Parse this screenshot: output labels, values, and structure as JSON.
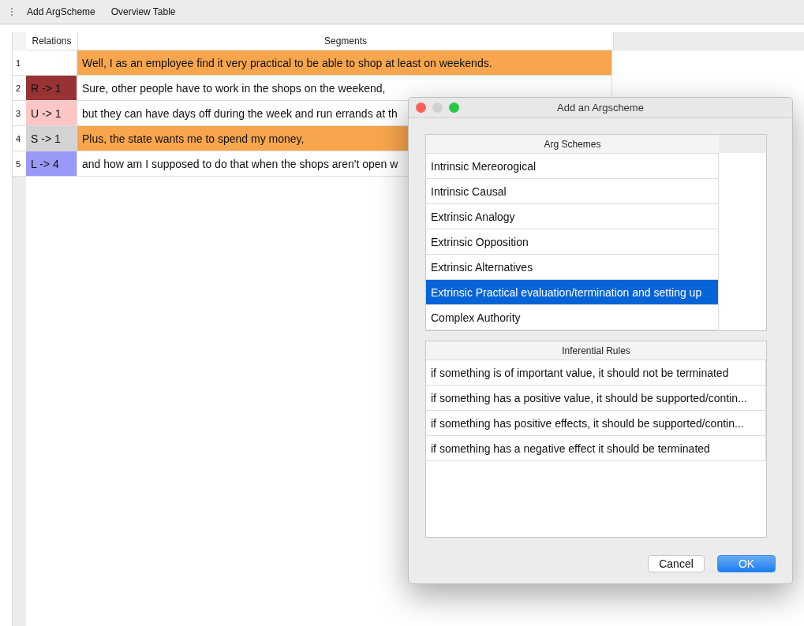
{
  "toolbar": {
    "items": [
      {
        "label": "Add ArgScheme"
      },
      {
        "label": "Overview Table"
      }
    ]
  },
  "table": {
    "columns": [
      "Relations",
      "Segments"
    ],
    "rows": [
      {
        "number": "1",
        "relation": {
          "color": "#ffffff"
        },
        "segment": {
          "text": "Well, I as an employee find it very practical to be able to shop at least on weekends.",
          "color": "#f8a64d"
        }
      },
      {
        "number": "2",
        "relation": {
          "text": "R -> 1",
          "color": "#993333"
        },
        "segment": {
          "text": "Sure, other people have to work in the shops on the weekend,",
          "color": "#ffffff"
        }
      },
      {
        "number": "3",
        "relation": {
          "text": "U -> 1",
          "color": "#ffc6c6"
        },
        "segment": {
          "text": "but they can have days off during the week and run errands at th",
          "color": "#ffffff"
        }
      },
      {
        "number": "4",
        "relation": {
          "text": "S -> 1",
          "color": "#d3d3d3"
        },
        "segment": {
          "text": "Plus, the state wants me to spend my money,",
          "color": "#f8a64d"
        }
      },
      {
        "number": "5",
        "relation": {
          "text": "L -> 4",
          "color": "#9999f8"
        },
        "segment": {
          "text": "and how am I supposed to do that when the shops aren't open w",
          "color": "#ffffff"
        }
      }
    ]
  },
  "dialog": {
    "title": "Add an Argscheme",
    "arg_schemes": {
      "header": "Arg Schemes",
      "items": [
        {
          "label": "Intrinsic Mereorogical",
          "selected": false
        },
        {
          "label": "Intrinsic Causal",
          "selected": false
        },
        {
          "label": "Extrinsic Analogy",
          "selected": false
        },
        {
          "label": "Extrinsic Opposition",
          "selected": false
        },
        {
          "label": "Extrinsic Alternatives",
          "selected": false
        },
        {
          "label": "Extrinsic Practical evaluation/termination and setting up",
          "selected": true
        },
        {
          "label": "Complex Authority",
          "selected": false
        }
      ]
    },
    "inferential_rules": {
      "header": "Inferential Rules",
      "items": [
        "if something is of important value, it should not be terminated",
        "if something has a positive value, it should be supported/contin...",
        "if something has positive effects, it should be supported/contin...",
        "if something has a negative effect it should be terminated"
      ]
    },
    "buttons": [
      {
        "label": "Cancel",
        "kind": "secondary"
      },
      {
        "label": "OK",
        "kind": "primary"
      }
    ]
  }
}
